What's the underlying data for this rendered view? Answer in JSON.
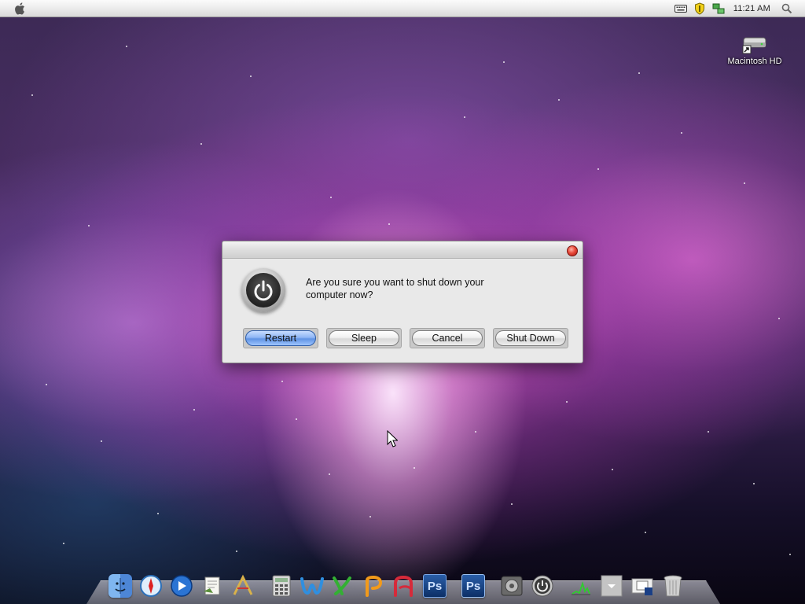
{
  "menubar": {
    "clock": "11:21 AM"
  },
  "desktop": {
    "icons": [
      {
        "label": "Macintosh HD"
      }
    ]
  },
  "dialog": {
    "message": "Are you sure you want to shut down your computer now?",
    "buttons": {
      "restart": "Restart",
      "sleep": "Sleep",
      "cancel": "Cancel",
      "shutdown": "Shut Down"
    },
    "default_button": "restart"
  },
  "dock": {
    "icons": [
      "finder-icon",
      "safari-icon",
      "quicktime-icon",
      "preview-icon",
      "text-editor-icon",
      "calculator-icon",
      "word-icon",
      "excel-icon",
      "powerpoint-icon",
      "access-icon",
      "photoshop-icon",
      "photoshop-cs-icon",
      "system-preferences-icon",
      "power-icon",
      "activity-monitor-icon",
      "downloads-stack-icon",
      "image-folder-icon",
      "trash-icon"
    ],
    "photoshop_label": "Ps"
  },
  "colors": {
    "default_button": "#7aa8ef",
    "close_button": "#e84a3a",
    "menubar": "#ececec"
  }
}
